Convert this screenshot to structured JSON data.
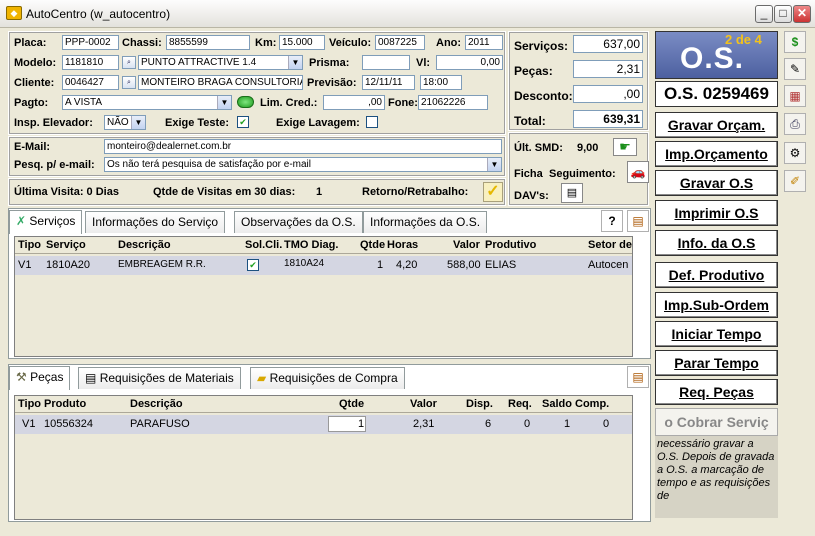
{
  "window": {
    "title": "AutoCentro (w_autocentro)",
    "min": "_",
    "max": "□",
    "close": "✕"
  },
  "form": {
    "placa_label": "Placa:",
    "placa": "PPP-0002",
    "chassi_label": "Chassi:",
    "chassi": "8855599",
    "km_label": "Km:",
    "km": "15.000",
    "veiculo_label": "Veículo:",
    "veiculo": "0087225",
    "ano_label": "Ano:",
    "ano": "2011",
    "modelo_label": "Modelo:",
    "modelo_code": "1181810",
    "modelo": "PUNTO ATTRACTIVE 1.4",
    "prisma_label": "Prisma:",
    "prisma": "",
    "vl_label": "Vl:",
    "vl": "0,00",
    "cliente_label": "Cliente:",
    "cliente_code": "0046427",
    "cliente": "MONTEIRO BRAGA CONSULTORIA",
    "previsao_label": "Previsão:",
    "previsao_date": "12/11/11",
    "previsao_time": "18:00",
    "pagto_label": "Pagto:",
    "pagto": "A VISTA",
    "limcred_label": "Lim. Cred.:",
    "limcred": ",00",
    "fone_label": "Fone:",
    "fone": "21062226",
    "insp_label": "Insp. Elevador:",
    "insp": "NÃO",
    "exige_teste_label": "Exige Teste:",
    "exige_lavagem_label": "Exige Lavagem:",
    "email_label": "E-Mail:",
    "email": "monteiro@dealernet.com.br",
    "pesq_label": "Pesq. p/ e-mail:",
    "pesq": "Os não terá pesquisa de satisfação por e-mail",
    "ultima_visita": "Última Visita:  0 Dias",
    "qtde_visitas": "Qtde de Visitas em 30 dias:",
    "qtde_visitas_val": "1",
    "retorno": "Retorno/Retrabalho:"
  },
  "totals": {
    "servicos_label": "Serviços:",
    "servicos": "637,00",
    "pecas_label": "Peças:",
    "pecas": "2,31",
    "desconto_label": "Desconto:",
    "desconto": ",00",
    "total_label": "Total:",
    "total": "639,31",
    "ult_smd_label": "Últ. SMD:",
    "ult_smd": "9,00",
    "ficha_label": "Ficha",
    "seguimento_label": "Seguimento:",
    "davs_label": "DAV's:"
  },
  "os": {
    "counter": "2 de 4",
    "big": "O.S.",
    "number": "O.S. 0259469"
  },
  "side_buttons": [
    "Gravar Orçam.",
    "Imp.Orçamento",
    "Gravar O.S",
    "Imprimir O.S",
    "Info. da O.S",
    "Def. Produtivo",
    "Imp.Sub-Ordem",
    "Iniciar Tempo",
    "Parar Tempo",
    "Req. Peças"
  ],
  "side_disabled": "o Cobrar Serviç",
  "side_note": "necessário gravar a O.S. Depois de gravada a O.S. a marcação de tempo e as requisições de",
  "tabs_serv": [
    "Serviços",
    "Informações do Serviço",
    "Observações da O.S.",
    "Informações da O.S."
  ],
  "serv_cols": [
    "Tipo",
    "Serviço",
    "Descrição",
    "Sol.Cli.",
    "TMO Diag.",
    "Qtde",
    "Horas",
    "Valor",
    "Produtivo",
    "Setor de"
  ],
  "serv_rows": [
    {
      "tipo": "V1",
      "servico": "1810A20",
      "descricao": "EMBREAGEM R.R.",
      "tmo": "1810A24",
      "qtde": "1",
      "horas": "4,20",
      "valor": "588,00",
      "produtivo": "ELIAS",
      "setor": "Autocen"
    }
  ],
  "tabs_pecas": [
    "Peças",
    "Requisições de Materiais",
    "Requisições de Compra"
  ],
  "pec_cols": [
    "Tipo",
    "Produto",
    "Descrição",
    "Qtde",
    "Valor",
    "Disp.",
    "Req.",
    "Saldo",
    "Comp."
  ],
  "pec_rows": [
    {
      "tipo": "V1",
      "produto": "10556324",
      "descricao": "PARAFUSO",
      "qtde": "1",
      "valor": "2,31",
      "disp": "6",
      "req": "0",
      "saldo": "1",
      "comp": "0"
    }
  ],
  "colors": {
    "os_panel": "#5b6fa8",
    "counter": "#f3c21b",
    "grid_row": "#d4d6e2"
  },
  "icons": [
    "dollar-icon",
    "notepad-icon",
    "chart-icon",
    "printer-icon",
    "gear-icon",
    "pencil-icon"
  ]
}
